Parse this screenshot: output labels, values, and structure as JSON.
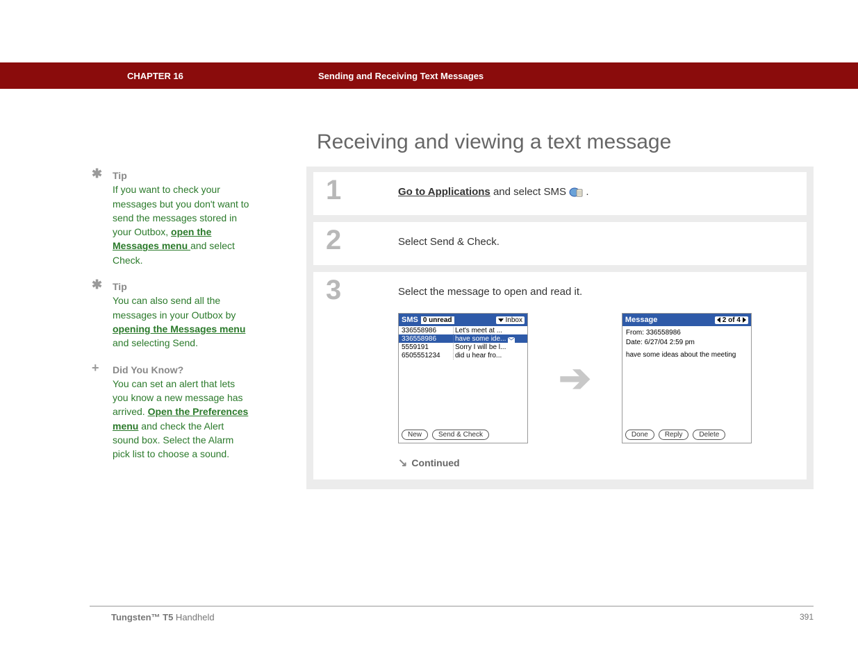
{
  "header": {
    "chapter": "CHAPTER 16",
    "subject": "Sending and Receiving Text Messages"
  },
  "title": "Receiving and viewing a text message",
  "sidebar": {
    "tip1": {
      "label": "Tip",
      "pre": "If you want to check your messages but you don't want to send the messages stored in your Outbox, ",
      "link": "open the Messages menu ",
      "post": "and select Check."
    },
    "tip2": {
      "label": "Tip",
      "pre": "You can also send all the messages in your Outbox by ",
      "link": "opening the Messages menu ",
      "post": "and selecting Send."
    },
    "dyk": {
      "label": "Did You Know?",
      "pre": "You can set an alert that lets you know a new message has arrived. ",
      "link": "Open the Preferences menu",
      "post": " and check the Alert sound box. Select the Alarm pick list to choose a sound."
    }
  },
  "steps": {
    "s1": {
      "num": "1",
      "link": "Go to Applications",
      "text_rest": " and select SMS ",
      "tail": "."
    },
    "s2": {
      "num": "2",
      "text": "Select Send & Check."
    },
    "s3": {
      "num": "3",
      "text": "Select the message to open and read it."
    }
  },
  "sms_list": {
    "title": "SMS",
    "unread": "0 unread",
    "folder": "Inbox",
    "rows": [
      {
        "who": "336558986",
        "sub": "Let's meet at ...",
        "sel": false
      },
      {
        "who": "336558986",
        "sub": "have some ide...",
        "sel": true
      },
      {
        "who": "5559191",
        "sub": "Sorry I will be l...",
        "sel": false
      },
      {
        "who": "6505551234",
        "sub": "did u hear fro...",
        "sel": false
      }
    ],
    "btn_new": "New",
    "btn_send": "Send & Check"
  },
  "sms_msg": {
    "title": "Message",
    "page": "2 of 4",
    "from_label": "From:",
    "from": "336558986",
    "date_label": "Date:",
    "date": "6/27/04 2:59 pm",
    "body": "have some ideas about the meeting",
    "btn_done": "Done",
    "btn_reply": "Reply",
    "btn_delete": "Delete"
  },
  "continued": "Continued",
  "footer": {
    "brand": "Tungsten™ T5",
    "rest": " Handheld",
    "page": "391"
  }
}
